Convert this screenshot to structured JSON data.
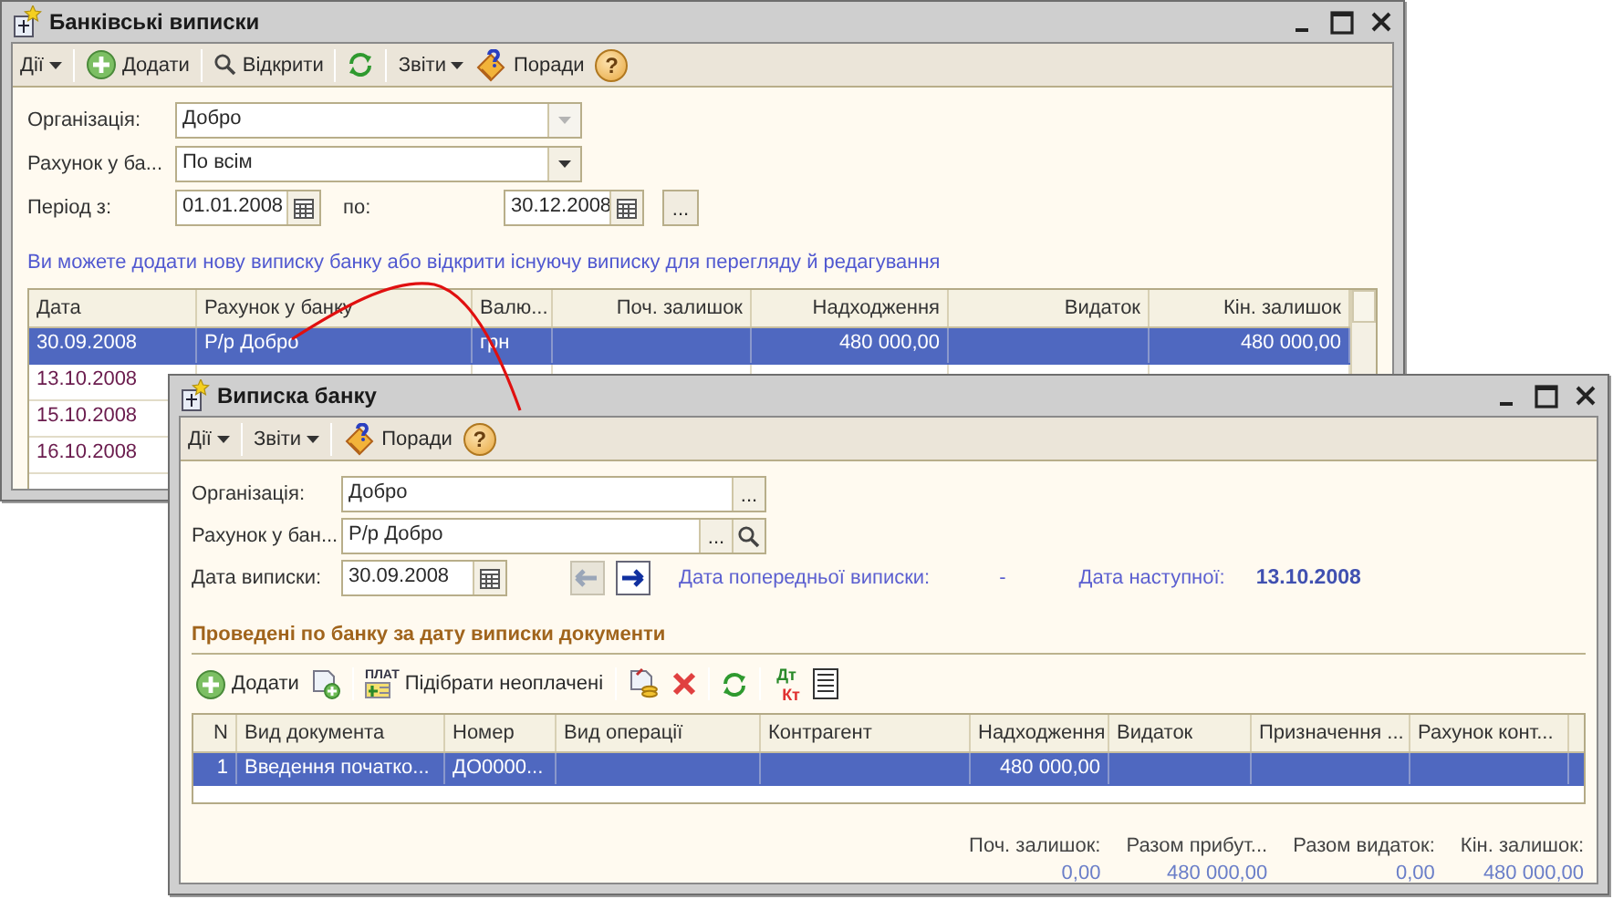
{
  "bank_statements": {
    "title": "Банківські виписки",
    "toolbar": [
      {
        "kind": "menu",
        "label": "Дії"
      },
      {
        "kind": "separator"
      },
      {
        "kind": "add",
        "label": "Додати"
      },
      {
        "kind": "separator"
      },
      {
        "kind": "open",
        "label": "Відкрити"
      },
      {
        "kind": "separator"
      },
      {
        "kind": "refresh"
      },
      {
        "kind": "separator"
      },
      {
        "kind": "menu",
        "label": "Звіти"
      },
      {
        "kind": "tips",
        "label": "Поради"
      },
      {
        "kind": "help",
        "glyph": "?"
      }
    ],
    "organization": {
      "label": "Організація:",
      "value": "Добро",
      "buttons": [
        {
          "kind": "dropdown",
          "disabled": true
        }
      ]
    },
    "bank_account": {
      "label": "Рахунок у ба...",
      "value": "По всім",
      "buttons": [
        {
          "kind": "dropdown",
          "disabled": false
        }
      ]
    },
    "period": {
      "label": "Період з:",
      "from": {
        "value": "01.01.2008",
        "buttons": [
          {
            "kind": "calendar"
          }
        ]
      },
      "to_label": "по:",
      "to": {
        "value": "30.12.2008",
        "buttons": [
          {
            "kind": "calendar"
          }
        ]
      },
      "select_button": "..."
    },
    "hint": "Ви можете додати нову виписку банку або відкрити існуючу виписку для перегляду й редагування",
    "table": {
      "columns": [
        {
          "label": "Дата"
        },
        {
          "label": "Рахунок у банку"
        },
        {
          "label": "Валю..."
        },
        {
          "label": "Поч. залишок"
        },
        {
          "label": "Надходження"
        },
        {
          "label": "Видаток"
        },
        {
          "label": "Кін. залишок"
        }
      ],
      "rows": [
        {
          "selected": true,
          "date": "30.09.2008",
          "account": "Р/р Добро",
          "currency": "грн",
          "income": "480 000,00",
          "closing_balance": "480 000,00"
        },
        {
          "selected": false,
          "date": "13.10.2008"
        },
        {
          "selected": false,
          "date": "15.10.2008"
        },
        {
          "selected": false,
          "date": "16.10.2008"
        }
      ]
    }
  },
  "bank_statement": {
    "title": "Виписка банку",
    "toolbar": [
      {
        "kind": "menu",
        "label": "Дії"
      },
      {
        "kind": "separator"
      },
      {
        "kind": "menu",
        "label": "Звіти"
      },
      {
        "kind": "separator"
      },
      {
        "kind": "tips",
        "label": "Поради"
      },
      {
        "kind": "help",
        "glyph": "?"
      }
    ],
    "organization": {
      "label": "Організація:",
      "value": "Добро",
      "buttons": [
        {
          "kind": "ellipsis",
          "label": "..."
        }
      ]
    },
    "bank_account": {
      "label": "Рахунок у бан...",
      "value": "Р/р Добро",
      "buttons": [
        {
          "kind": "ellipsis",
          "label": "..."
        },
        {
          "kind": "search"
        }
      ]
    },
    "statement_date": {
      "label": "Дата виписки:",
      "value": "30.09.2008",
      "buttons": [
        {
          "kind": "calendar"
        }
      ]
    },
    "statement_nav": [
      {
        "kind": "previous",
        "disabled": true
      },
      {
        "kind": "next",
        "disabled": false
      }
    ],
    "previous_statement": {
      "label": "Дата попередньої виписки:",
      "value": "-"
    },
    "next_statement": {
      "label": "Дата наступної:",
      "value": "13.10.2008"
    },
    "documents_section": {
      "title": "Проведені по банку за дату виписки документи",
      "toolbar": [
        {
          "kind": "add",
          "label": "Додати"
        },
        {
          "kind": "doc-add"
        },
        {
          "kind": "separator"
        },
        {
          "kind": "pick",
          "badge": "ПЛАТ",
          "label": "Підібрати неоплачені"
        },
        {
          "kind": "separator"
        },
        {
          "kind": "doc-coins"
        },
        {
          "kind": "delete"
        },
        {
          "kind": "separator"
        },
        {
          "kind": "refresh"
        },
        {
          "kind": "separator"
        },
        {
          "kind": "dtkt",
          "debit": "Дт",
          "credit": "Кт"
        },
        {
          "kind": "list"
        }
      ],
      "table": {
        "columns": [
          {
            "label": "N"
          },
          {
            "label": "Вид документа"
          },
          {
            "label": "Номер"
          },
          {
            "label": "Вид операції"
          },
          {
            "label": "Контрагент"
          },
          {
            "label": "Надходження"
          },
          {
            "label": "Видаток"
          },
          {
            "label": "Призначення ..."
          },
          {
            "label": "Рахунок конт..."
          }
        ],
        "rows": [
          {
            "selected": true,
            "n": "1",
            "document_type": "Введення початко...",
            "number": "ДО0000...",
            "income": "480 000,00"
          }
        ]
      }
    },
    "totals": [
      {
        "label": "Поч. залишок:",
        "value": "0,00"
      },
      {
        "label": "Разом прибут...",
        "value": "480 000,00"
      },
      {
        "label": "Разом видаток:",
        "value": "0,00"
      },
      {
        "label": "Кін. залишок:",
        "value": "480 000,00"
      }
    ]
  }
}
